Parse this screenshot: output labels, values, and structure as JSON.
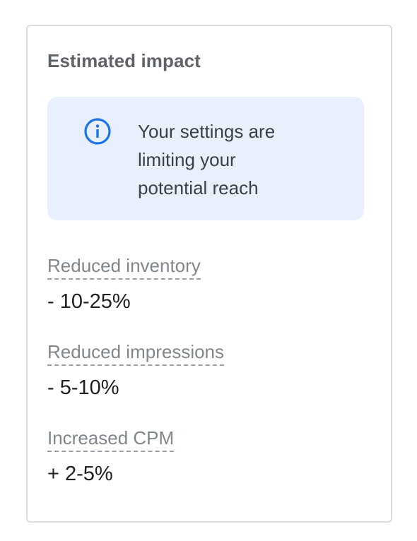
{
  "card": {
    "title": "Estimated impact"
  },
  "info": {
    "icon": "info-icon",
    "accent_color": "#1a73e8",
    "message_line1": "Your settings are",
    "message_line2": "limiting your",
    "message_line3": "potential reach"
  },
  "metrics": [
    {
      "label": "Reduced inventory",
      "value": "- 10-25%"
    },
    {
      "label": "Reduced impressions",
      "value": "- 5-10%"
    },
    {
      "label": "Increased CPM",
      "value": "+ 2-5%"
    }
  ]
}
